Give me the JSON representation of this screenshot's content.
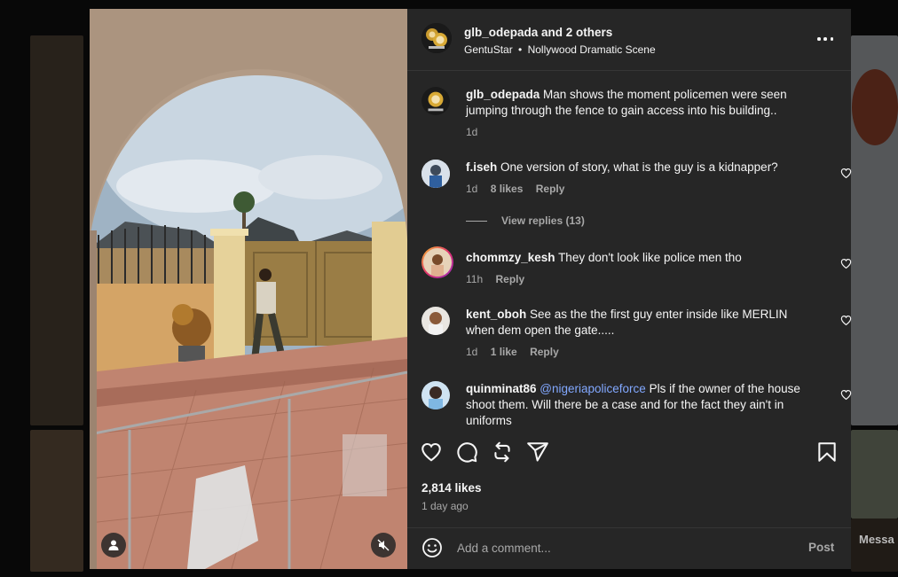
{
  "background": {
    "right_partial_text": "Messa"
  },
  "post": {
    "author": "glb_odepada",
    "coauthors_text": "and 2 others",
    "subtitle_account": "GentuStar",
    "subtitle_separator": "•",
    "subtitle_audio": "Nollywood Dramatic Scene",
    "caption_user": "glb_odepada",
    "caption_text": "Man shows the moment policemen were seen jumping through the fence to gain access into his building..",
    "caption_time": "1d",
    "likes": "2,814 likes",
    "time_ago": "1 day ago"
  },
  "comments": [
    {
      "user": "f.iseh",
      "text": "One version of story, what is the guy is a kidnapper?",
      "time": "1d",
      "likes": "8 likes",
      "reply": "Reply",
      "view_replies": "View replies (13)"
    },
    {
      "user": "chommzy_kesh",
      "text": "They don't look like police men tho",
      "time": "11h",
      "reply": "Reply"
    },
    {
      "user": "kent_oboh",
      "text": "See as the the first guy enter inside like MERLIN when dem open the gate.....",
      "time": "1d",
      "likes": "1 like",
      "reply": "Reply"
    },
    {
      "user": "quinminat86",
      "mention": "@nigeriapoliceforce",
      "text": "Pls if the owner of the house shoot them. Will there be a case and for the fact they ain't in uniforms"
    }
  ],
  "add_comment": {
    "placeholder": "Add a comment...",
    "post_label": "Post"
  },
  "colors": {
    "panel_bg": "#262626",
    "text": "#f5f5f5",
    "muted": "#a8a8a8",
    "mention": "#82a8ff",
    "divider": "#363636"
  },
  "icons": {
    "more": "more-icon",
    "like": "heart-icon",
    "comment": "comment-icon",
    "repost": "repost-icon",
    "share": "share-icon",
    "save": "bookmark-icon",
    "emoji": "emoji-icon",
    "user_tag": "user-tag-icon",
    "mute": "mute-icon"
  }
}
